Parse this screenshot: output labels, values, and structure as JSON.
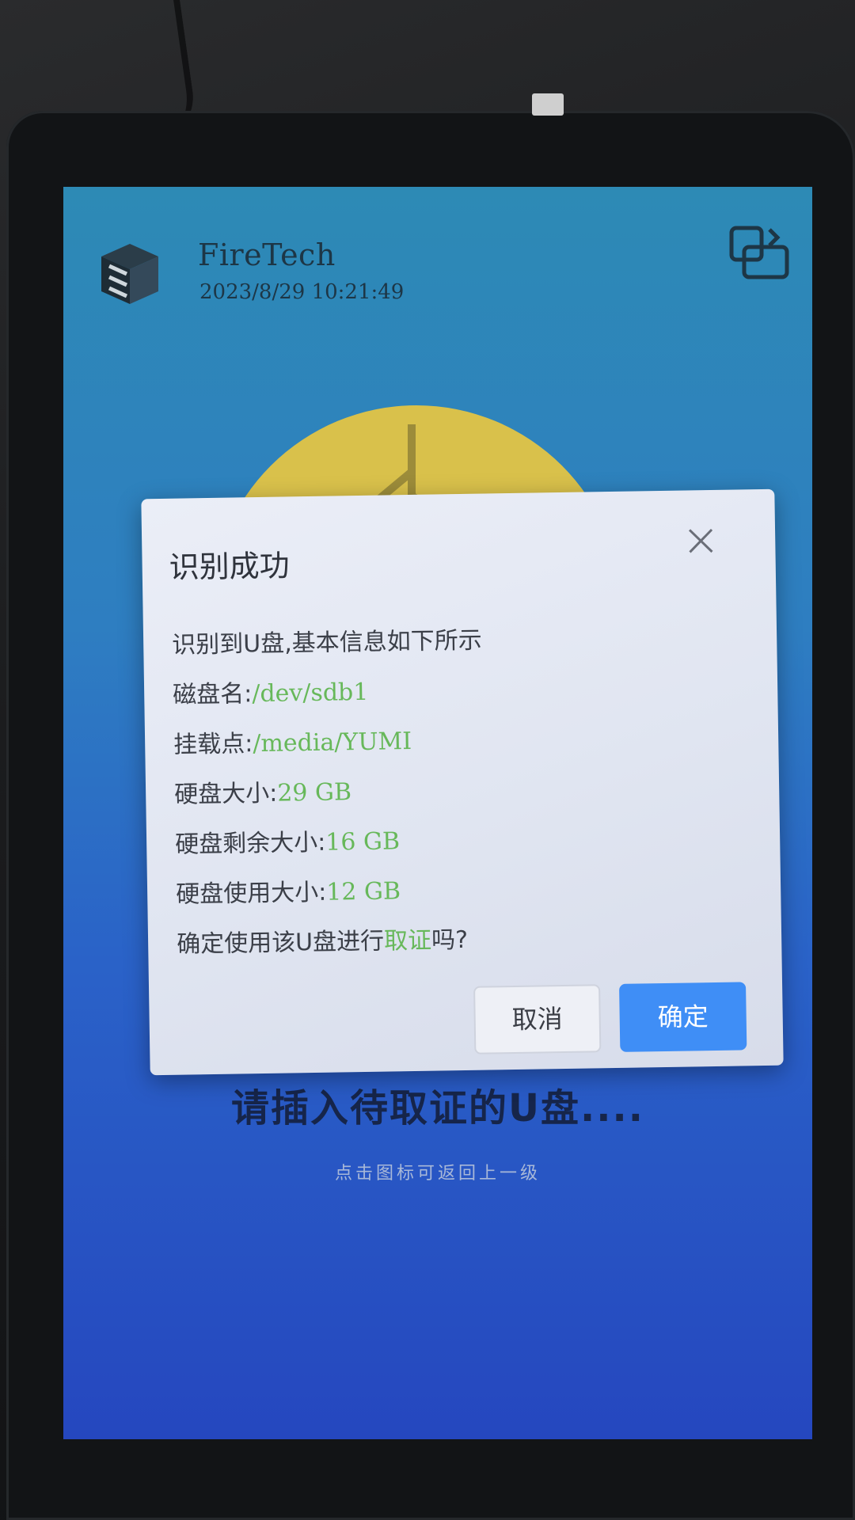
{
  "header": {
    "brand": "FireTech",
    "datetime": "2023/8/29 10:21:49",
    "logo_icon": "firetech-logo-icon",
    "top_right_icon": "switch-window-icon"
  },
  "main": {
    "illustration_icon": "usb-symbol-icon",
    "prompt": "请插入待取证的U盘....",
    "hint": "点击图标可返回上一级"
  },
  "dialog": {
    "title": "识别成功",
    "intro": "识别到U盘,基本信息如下所示",
    "fields": [
      {
        "label": "磁盘名:",
        "value": "/dev/sdb1"
      },
      {
        "label": "挂载点:",
        "value": "/media/YUMI"
      },
      {
        "label": "硬盘大小:",
        "value": "29 GB"
      },
      {
        "label": "硬盘剩余大小:",
        "value": "16 GB"
      },
      {
        "label": "硬盘使用大小:",
        "value": "12 GB"
      }
    ],
    "question_prefix": "确定使用该U盘进行",
    "question_highlight": "取证",
    "question_suffix": "吗?",
    "cancel_label": "取消",
    "ok_label": "确定",
    "close_icon": "close-icon"
  },
  "colors": {
    "accent": "#3f8ef6",
    "value_green": "#67b85a"
  }
}
